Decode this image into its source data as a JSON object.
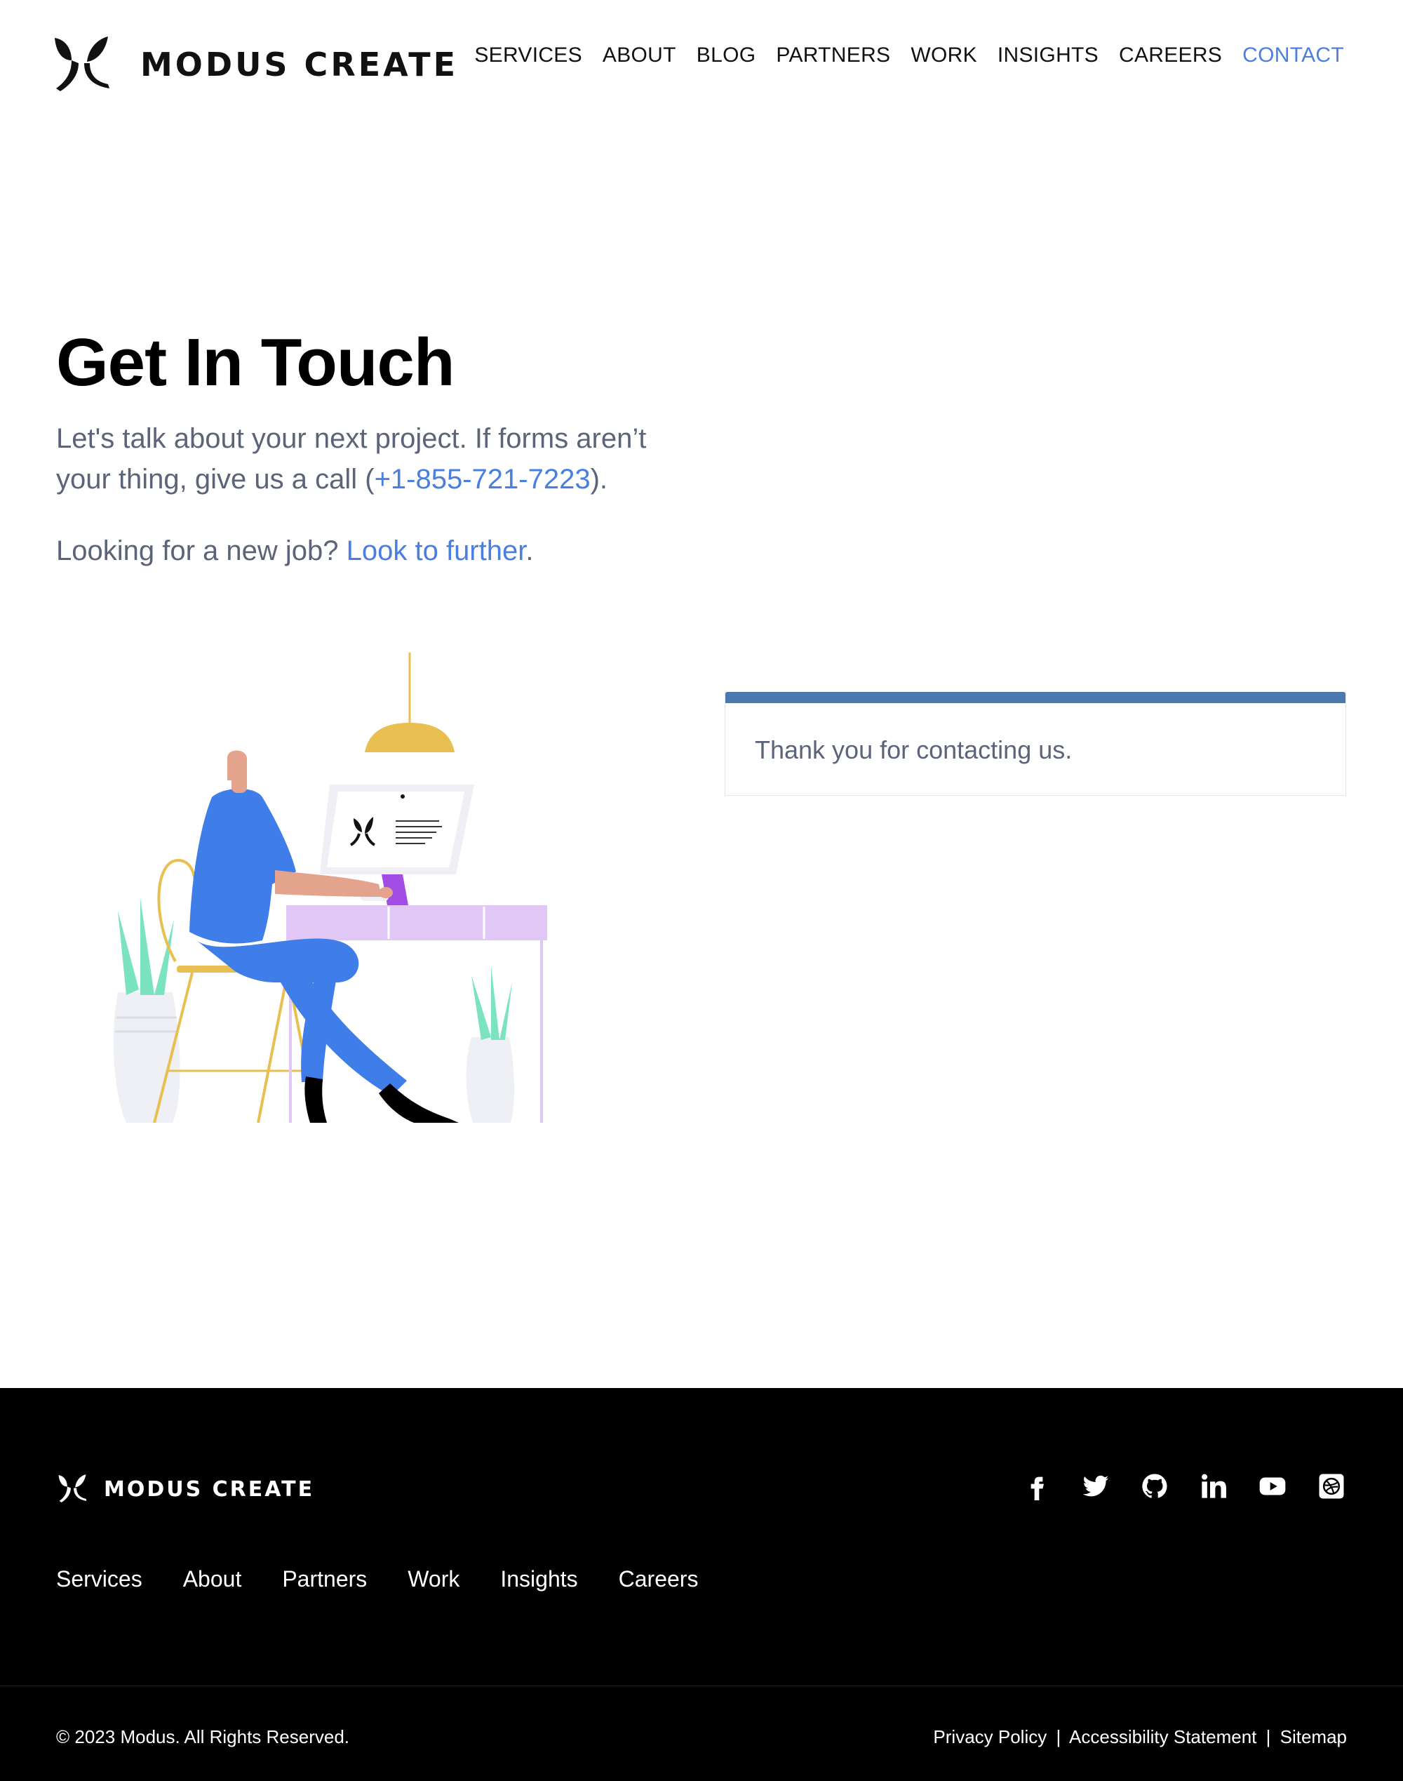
{
  "header": {
    "brand": "MODUS CREATE",
    "nav": [
      "SERVICES",
      "ABOUT",
      "BLOG",
      "PARTNERS",
      "WORK",
      "INSIGHTS",
      "CAREERS",
      "CONTACT"
    ],
    "active_nav": "CONTACT"
  },
  "hero": {
    "title": "Get In Touch",
    "p1_before": "Let's talk about your next project. If forms aren’t your thing, give us a call (",
    "phone": "+1-855-721-7223",
    "p1_after": ").",
    "p2_before": "Looking for a new job? ",
    "p2_link": "Look to further",
    "p2_after": "."
  },
  "card": {
    "message": "Thank you for contacting us."
  },
  "footer": {
    "brand": "MODUS CREATE",
    "social": [
      "facebook-icon",
      "twitter-icon",
      "github-icon",
      "linkedin-icon",
      "youtube-icon",
      "dribbble-icon"
    ],
    "nav": [
      "Services",
      "About",
      "Partners",
      "Work",
      "Insights",
      "Careers"
    ],
    "copyright": "© 2023 Modus. All Rights Reserved.",
    "legal": [
      "Privacy Policy",
      "Accessibility Statement",
      "Sitemap"
    ],
    "legal_separator": "|"
  },
  "colors": {
    "accent": "#4a7fe0",
    "card_bar": "#4b79ae",
    "text_muted": "#5b6478",
    "footer_bg": "#000000"
  }
}
